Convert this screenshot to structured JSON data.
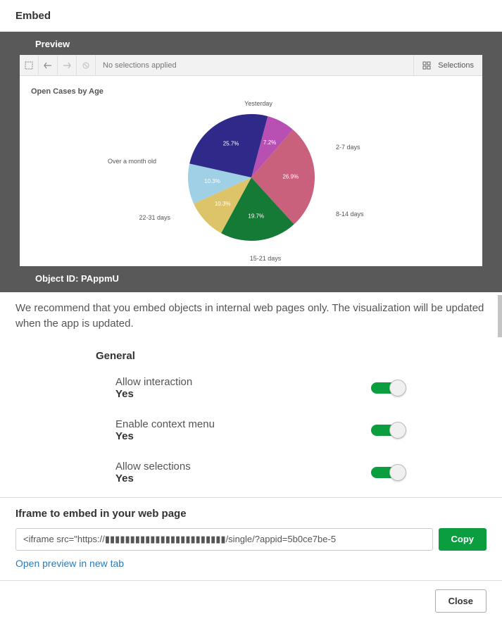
{
  "header": {
    "title": "Embed"
  },
  "preview": {
    "label": "Preview",
    "toolbar_no_selections": "No selections applied",
    "toolbar_selections_label": "Selections",
    "chart_title": "Open Cases by Age",
    "object_id_label": "Object ID: PAppmU"
  },
  "chart_data": {
    "type": "pie",
    "title": "Open Cases by Age",
    "series": [
      {
        "name": "2-7 days",
        "value": 26.9,
        "label": "26.9%",
        "color": "#c9607c"
      },
      {
        "name": "8-14 days",
        "value": 19.7,
        "label": "19.7%",
        "color": "#147a36"
      },
      {
        "name": "15-21 days",
        "value": 10.3,
        "label": "10.3%",
        "color": "#ddc468"
      },
      {
        "name": "22-31 days",
        "value": 10.3,
        "label": "10.3%",
        "color": "#9fd0e6"
      },
      {
        "name": "Over a month old",
        "value": 25.7,
        "label": "25.7%",
        "color": "#2f2a8a"
      },
      {
        "name": "Yesterday",
        "value": 7.2,
        "label": "7.2%",
        "color": "#b84fb3"
      }
    ]
  },
  "body": {
    "description": "We recommend that you embed objects in internal web pages only. The visualization will be updated when the app is updated.",
    "section_general": "General",
    "options": [
      {
        "label": "Allow interaction",
        "value": "Yes"
      },
      {
        "label": "Enable context menu",
        "value": "Yes"
      },
      {
        "label": "Allow selections",
        "value": "Yes"
      }
    ]
  },
  "iframe": {
    "heading": "Iframe to embed in your web page",
    "code": "<iframe src=\"https://▮▮▮▮▮▮▮▮▮▮▮▮▮▮▮▮▮▮▮▮▮▮▮▮/single/?appid=5b0ce7be-5",
    "copy_label": "Copy",
    "open_link": "Open preview in new tab"
  },
  "footer": {
    "close_label": "Close"
  }
}
